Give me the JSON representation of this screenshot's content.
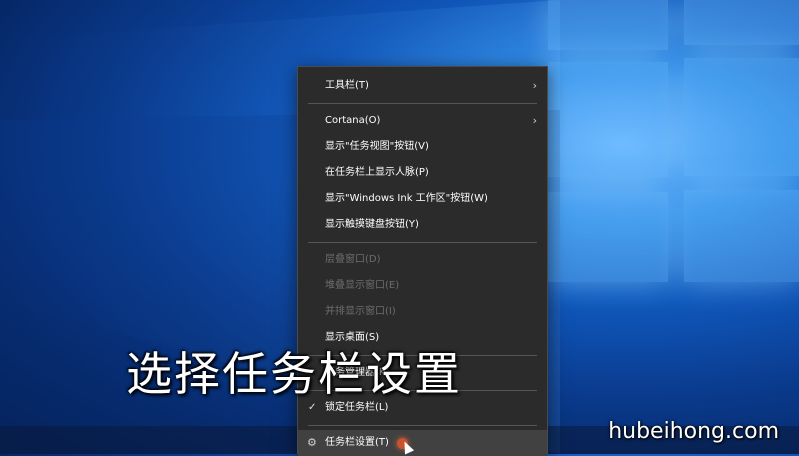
{
  "context_menu": {
    "items": [
      {
        "label": "工具栏(T)",
        "submenu": true,
        "disabled": false
      },
      {
        "label": "Cortana(O)",
        "submenu": true,
        "disabled": false
      },
      {
        "label": "显示\"任务视图\"按钮(V)",
        "disabled": false
      },
      {
        "label": "在任务栏上显示人脉(P)",
        "disabled": false
      },
      {
        "label": "显示\"Windows Ink 工作区\"按钮(W)",
        "disabled": false
      },
      {
        "label": "显示触摸键盘按钮(Y)",
        "disabled": false
      },
      {
        "label": "层叠窗口(D)",
        "disabled": true
      },
      {
        "label": "堆叠显示窗口(E)",
        "disabled": true
      },
      {
        "label": "并排显示窗口(I)",
        "disabled": true
      },
      {
        "label": "显示桌面(S)",
        "disabled": false
      },
      {
        "label": "任务管理器(K)",
        "disabled": false
      },
      {
        "label": "锁定任务栏(L)",
        "checked": true,
        "disabled": false
      },
      {
        "label": "任务栏设置(T)",
        "icon": "gear-icon",
        "disabled": false
      }
    ],
    "arrow_glyph": "›",
    "check_glyph": "✓",
    "gear_glyph": "⚙"
  },
  "caption": "选择任务栏设置",
  "watermark": "hubeihong.com"
}
